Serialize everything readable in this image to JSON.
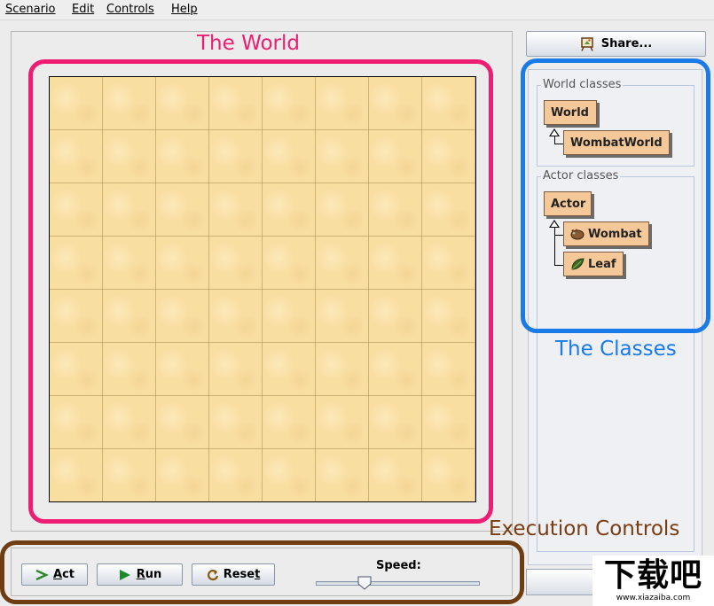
{
  "menu": [
    "Scenario",
    "Edit",
    "Controls",
    "Help"
  ],
  "annotations": {
    "world": "The World",
    "classes": "The Classes",
    "execution": "Execution Controls"
  },
  "colors": {
    "world_annotation": "#ee1c72",
    "classes_annotation": "#1a7ae8",
    "execution_annotation": "#6e3e12",
    "world_background": "#f9dea2",
    "class_box": "#f4c898"
  },
  "share_button": {
    "label": "Share...",
    "icon": "easel-icon"
  },
  "world_grid": {
    "columns": 8,
    "rows": 8
  },
  "world_classes": {
    "legend": "World classes",
    "items": [
      {
        "label": "World"
      },
      {
        "label": "WombatWorld"
      }
    ]
  },
  "actor_classes": {
    "legend": "Actor classes",
    "items": [
      {
        "label": "Actor"
      },
      {
        "label": "Wombat",
        "icon": "wombat-icon"
      },
      {
        "label": "Leaf",
        "icon": "leaf-icon"
      }
    ]
  },
  "controls": {
    "act": {
      "pre": "",
      "key": "A",
      "post": "ct"
    },
    "run": {
      "pre": "",
      "key": "R",
      "post": "un"
    },
    "reset": {
      "pre": "Rese",
      "key": "t",
      "post": ""
    },
    "speed_label": "Speed:",
    "speed_value": 0.28
  },
  "watermark": {
    "main": "下载吧",
    "sub": "www.xiazaiba.com"
  }
}
